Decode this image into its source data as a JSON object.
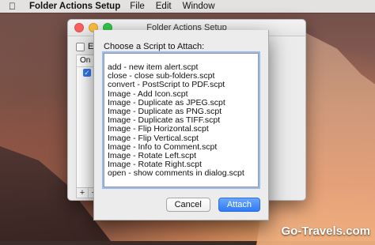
{
  "menubar": {
    "app_name": "Folder Actions Setup",
    "menus": [
      "File",
      "Edit",
      "Window"
    ]
  },
  "background_window": {
    "title": "Folder Actions Setup",
    "enable_label": "Ena",
    "column_header": "On",
    "plus": "+",
    "minus": "−"
  },
  "sheet": {
    "title": "Choose a Script to Attach:",
    "items": [
      "add - new item alert.scpt",
      "close - close sub-folders.scpt",
      "convert - PostScript to PDF.scpt",
      "Image - Add Icon.scpt",
      "Image - Duplicate as JPEG.scpt",
      "Image - Duplicate as PNG.scpt",
      "Image - Duplicate as TIFF.scpt",
      "Image - Flip Horizontal.scpt",
      "Image - Flip Vertical.scpt",
      "Image - Info to Comment.scpt",
      "Image - Rotate Left.scpt",
      "Image - Rotate Right.scpt",
      "open - show comments in dialog.scpt"
    ],
    "cancel": "Cancel",
    "attach": "Attach"
  },
  "watermark": "Go-Travels.com",
  "icons": {
    "apple": "apple-icon",
    "check": "checkmark-icon"
  }
}
